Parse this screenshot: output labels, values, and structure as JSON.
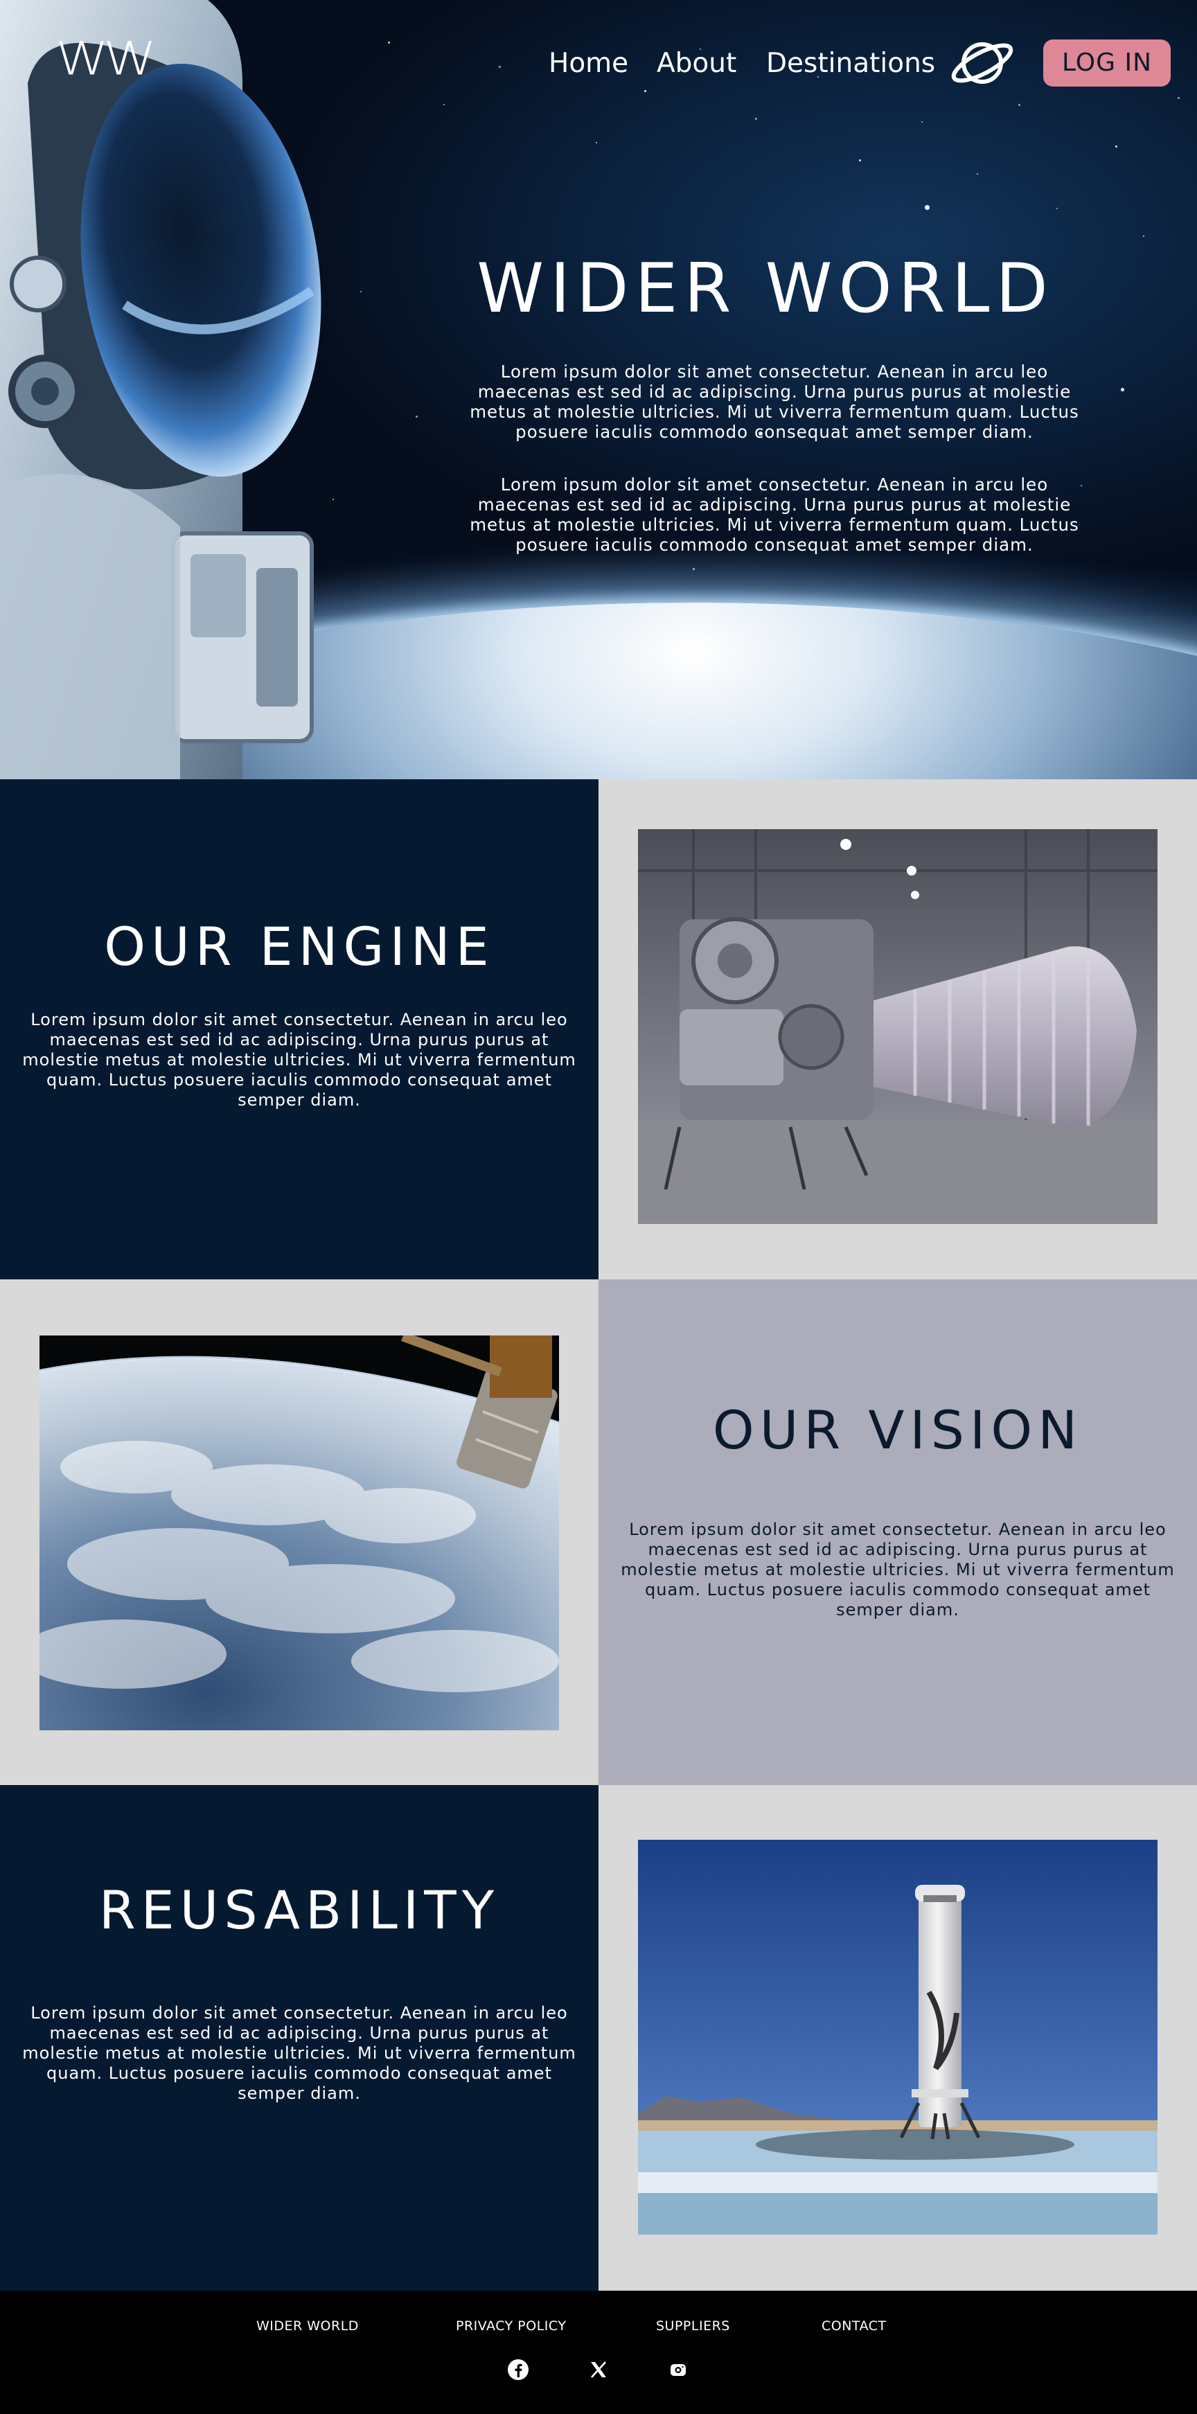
{
  "header": {
    "logo": "WW",
    "nav": [
      {
        "label": "Home"
      },
      {
        "label": "About"
      },
      {
        "label": "Destinations"
      }
    ],
    "planet_icon": "planet-icon",
    "login_label": "LOG IN"
  },
  "hero": {
    "title": "WIDER WORLD",
    "paragraphs": [
      "Lorem ipsum dolor sit amet consectetur. Aenean in arcu leo maecenas est sed id ac adipiscing. Urna purus purus at molestie metus at molestie ultricies. Mi ut viverra fermentum quam. Luctus posuere iaculis commodo consequat amet semper diam.",
      "Lorem ipsum dolor sit amet consectetur. Aenean in arcu leo maecenas est sed id ac adipiscing. Urna purus purus at molestie metus at molestie ultricies. Mi ut viverra fermentum quam. Luctus posuere iaculis commodo consequat amet semper diam."
    ]
  },
  "sections": [
    {
      "title": "OUR ENGINE",
      "text": "Lorem ipsum dolor sit amet consectetur. Aenean in arcu leo maecenas est sed id ac adipiscing. Urna purus purus at molestie metus at molestie ultricies. Mi ut viverra fermentum quam. Luctus posuere iaculis commodo consequat amet semper diam.",
      "image": "rocket-engine-photo"
    },
    {
      "title": "OUR VISION",
      "text": "Lorem ipsum dolor sit amet consectetur. Aenean in arcu leo maecenas est sed id ac adipiscing. Urna purus purus at molestie metus at molestie ultricies. Mi ut viverra fermentum quam. Luctus posuere iaculis commodo consequat amet semper diam.",
      "image": "earth-from-orbit-photo"
    },
    {
      "title": "REUSABILITY",
      "text": "Lorem ipsum dolor sit amet consectetur. Aenean in arcu leo maecenas est sed id ac adipiscing. Urna purus purus at molestie metus at molestie ultricies. Mi ut viverra fermentum quam. Luctus posuere iaculis commodo consequat amet semper diam.",
      "image": "landed-rocket-booster-photo"
    }
  ],
  "footer": {
    "links": [
      {
        "label": "WIDER WORLD"
      },
      {
        "label": "PRIVACY POLICY"
      },
      {
        "label": "SUPPLIERS"
      },
      {
        "label": "CONTACT"
      }
    ],
    "social_icons": [
      "facebook-icon",
      "x-icon",
      "instagram-icon"
    ]
  },
  "colors": {
    "navy": "#051a31",
    "grey": "#d9d9d9",
    "lavender": "#acacbb",
    "login_pink": "#de8796",
    "footer": "#000000"
  }
}
